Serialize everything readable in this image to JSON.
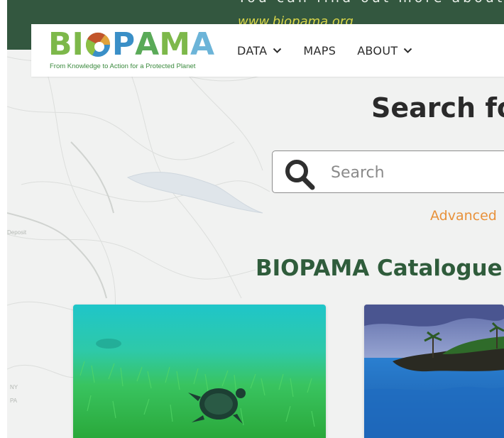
{
  "banner": {
    "text": "You can find out more about BIOPAMA",
    "link": "www.biopama.org"
  },
  "logo": {
    "letters": [
      "B",
      "I",
      "O",
      "P",
      "A",
      "M",
      "A"
    ],
    "tagline": "From Knowledge to Action for a Protected Planet"
  },
  "nav": {
    "items": [
      {
        "label": "DATA",
        "has_dropdown": true
      },
      {
        "label": "MAPS",
        "has_dropdown": false
      },
      {
        "label": "ABOUT",
        "has_dropdown": true
      }
    ]
  },
  "main": {
    "title": "Search fo",
    "search": {
      "placeholder": "Search"
    },
    "advanced_link": "Advanced",
    "section_title": "BIOPAMA Catalogue"
  },
  "map_labels": [
    "Deposit",
    "NY",
    "PA"
  ],
  "colors": {
    "banner_green": "#33573f",
    "accent_orange": "#e8913a",
    "heading_green": "#2f5c3b",
    "logo_green": "#7db84a",
    "logo_blue": "#3a8fc7"
  }
}
